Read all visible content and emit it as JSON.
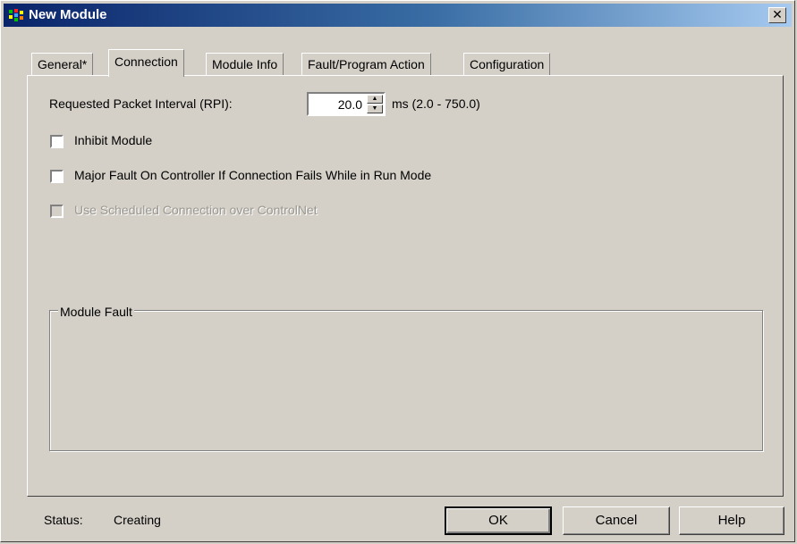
{
  "window": {
    "title": "New Module",
    "close_label": "✕"
  },
  "tabs": [
    {
      "label": "General*",
      "active": false
    },
    {
      "label": "Connection",
      "active": true
    },
    {
      "label": "Module Info",
      "active": false
    },
    {
      "label": "Fault/Program Action",
      "active": false
    },
    {
      "label": "Configuration",
      "active": false
    }
  ],
  "connection": {
    "rpi_label": "Requested Packet Interval (RPI):",
    "rpi_value": "20.0",
    "rpi_range": "ms (2.0 - 750.0)",
    "spin_up": "▲",
    "spin_down": "▼",
    "inhibit_label": "Inhibit Module",
    "inhibit_checked": false,
    "major_fault_label": "Major Fault On Controller If Connection Fails While in Run Mode",
    "major_fault_checked": false,
    "scheduled_label": "Use Scheduled Connection over ControlNet",
    "scheduled_checked": false,
    "scheduled_disabled": true
  },
  "module_fault": {
    "legend": "Module Fault",
    "content": ""
  },
  "status": {
    "label": "Status:",
    "value": "Creating"
  },
  "buttons": {
    "ok": "OK",
    "cancel": "Cancel",
    "help": "Help"
  },
  "icons": {
    "app": "module-tree-icon",
    "close": "close-icon"
  }
}
